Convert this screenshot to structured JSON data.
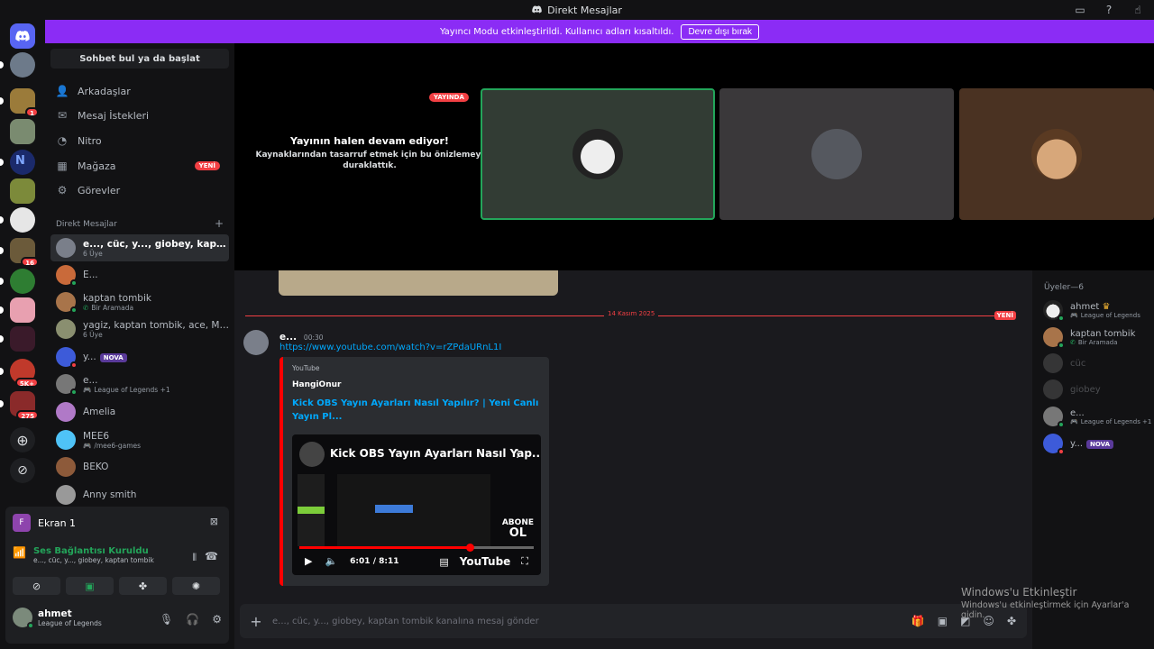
{
  "window": {
    "title": "Direkt Mesajlar"
  },
  "banner": {
    "text": "Yayıncı Modu etkinleştirildi. Kullanıcı adları kısaltıldı.",
    "button": "Devre dışı bırak"
  },
  "guild_badges": [
    "1",
    "16",
    "5K+",
    "275"
  ],
  "search": {
    "label": "Sohbet bul ya da başlat"
  },
  "nav": [
    {
      "label": "Arkadaşlar",
      "icon": "friends-icon"
    },
    {
      "label": "Mesaj İstekleri",
      "icon": "mail-icon"
    },
    {
      "label": "Nitro",
      "icon": "nitro-icon"
    },
    {
      "label": "Mağaza",
      "icon": "shop-icon",
      "badge": "YENİ"
    },
    {
      "label": "Görevler",
      "icon": "quests-icon"
    }
  ],
  "dm_header": {
    "label": "Direkt Mesajlar",
    "add": "+"
  },
  "dms": [
    {
      "name": "e..., cüc, y..., giobey, kaptan to...",
      "sub": "6 Üye"
    },
    {
      "name": "E...",
      "sub": ""
    },
    {
      "name": "kaptan tombik",
      "sub": "Bir Aramada"
    },
    {
      "name": "yagiz, kaptan tombik, ace, Mr....",
      "sub": "6 Üye"
    },
    {
      "name": "y...",
      "sub": "",
      "badge": "NOVA"
    },
    {
      "name": "e...",
      "sub": "League of Legends +1"
    },
    {
      "name": "Amelia",
      "sub": ""
    },
    {
      "name": "MEE6",
      "sub": "/mee6-games"
    },
    {
      "name": "BEKO",
      "sub": ""
    },
    {
      "name": "Anny smith",
      "sub": ""
    }
  ],
  "voice": {
    "screen_label": "Ekran 1",
    "screen_initial": "F",
    "status": "Ses Bağlantısı Kuruldu",
    "channel": "e..., cüc, y..., giobey, kaptan tombik"
  },
  "user": {
    "name": "ahmet",
    "status": "League of Legends"
  },
  "stage": {
    "live_badge": "YAYINDA",
    "heading": "Yayının halen devam ediyor!",
    "body": "Kaynaklarından tasarruf etmek için bu önizlemeyi duraklattık."
  },
  "chat": {
    "divider_date": "14 Kasım 2025",
    "divider_new": "YENİ",
    "message": {
      "author": "e...",
      "time": "00:30",
      "link": "https://www.youtube.com/watch?v=rZPdaURnL1I"
    },
    "embed": {
      "provider": "YouTube",
      "author": "HangiOnur",
      "title": "Kick OBS Yayın Ayarları Nasıl Yapılır? | Yeni Canlı Yayın Pl...",
      "video_title": "Kick OBS Yayın Ayarları Nasıl Yap...",
      "progress": 0.73,
      "time": "6:01 / 8:11",
      "abone": "ABONE",
      "ol": "OL",
      "yt_logo": "YouTube"
    },
    "composer_placeholder": "e..., cüc, y..., giobey, kaptan tombik kanalına mesaj gönder"
  },
  "members": {
    "header": "Üyeler—6",
    "list": [
      {
        "name": "ahmet",
        "sub": "League of Legends",
        "crown": "♛",
        "offline": false
      },
      {
        "name": "kaptan tombik",
        "sub": "Bir Aramada",
        "offline": false
      },
      {
        "name": "cüc",
        "sub": "",
        "offline": true
      },
      {
        "name": "giobey",
        "sub": "",
        "offline": true
      },
      {
        "name": "e...",
        "sub": "League of Legends +1",
        "offline": false
      },
      {
        "name": "y...",
        "sub": "",
        "badge": "NOVA",
        "offline": false
      }
    ]
  },
  "watermark": {
    "line1": "Windows'u Etkinleştir",
    "line2": "Windows'u etkinleştirmek için Ayarlar'a gidin."
  },
  "colors": {
    "accent": "#8b2cf5",
    "online": "#23a55a",
    "danger": "#f23f43",
    "link": "#00a8fc"
  }
}
